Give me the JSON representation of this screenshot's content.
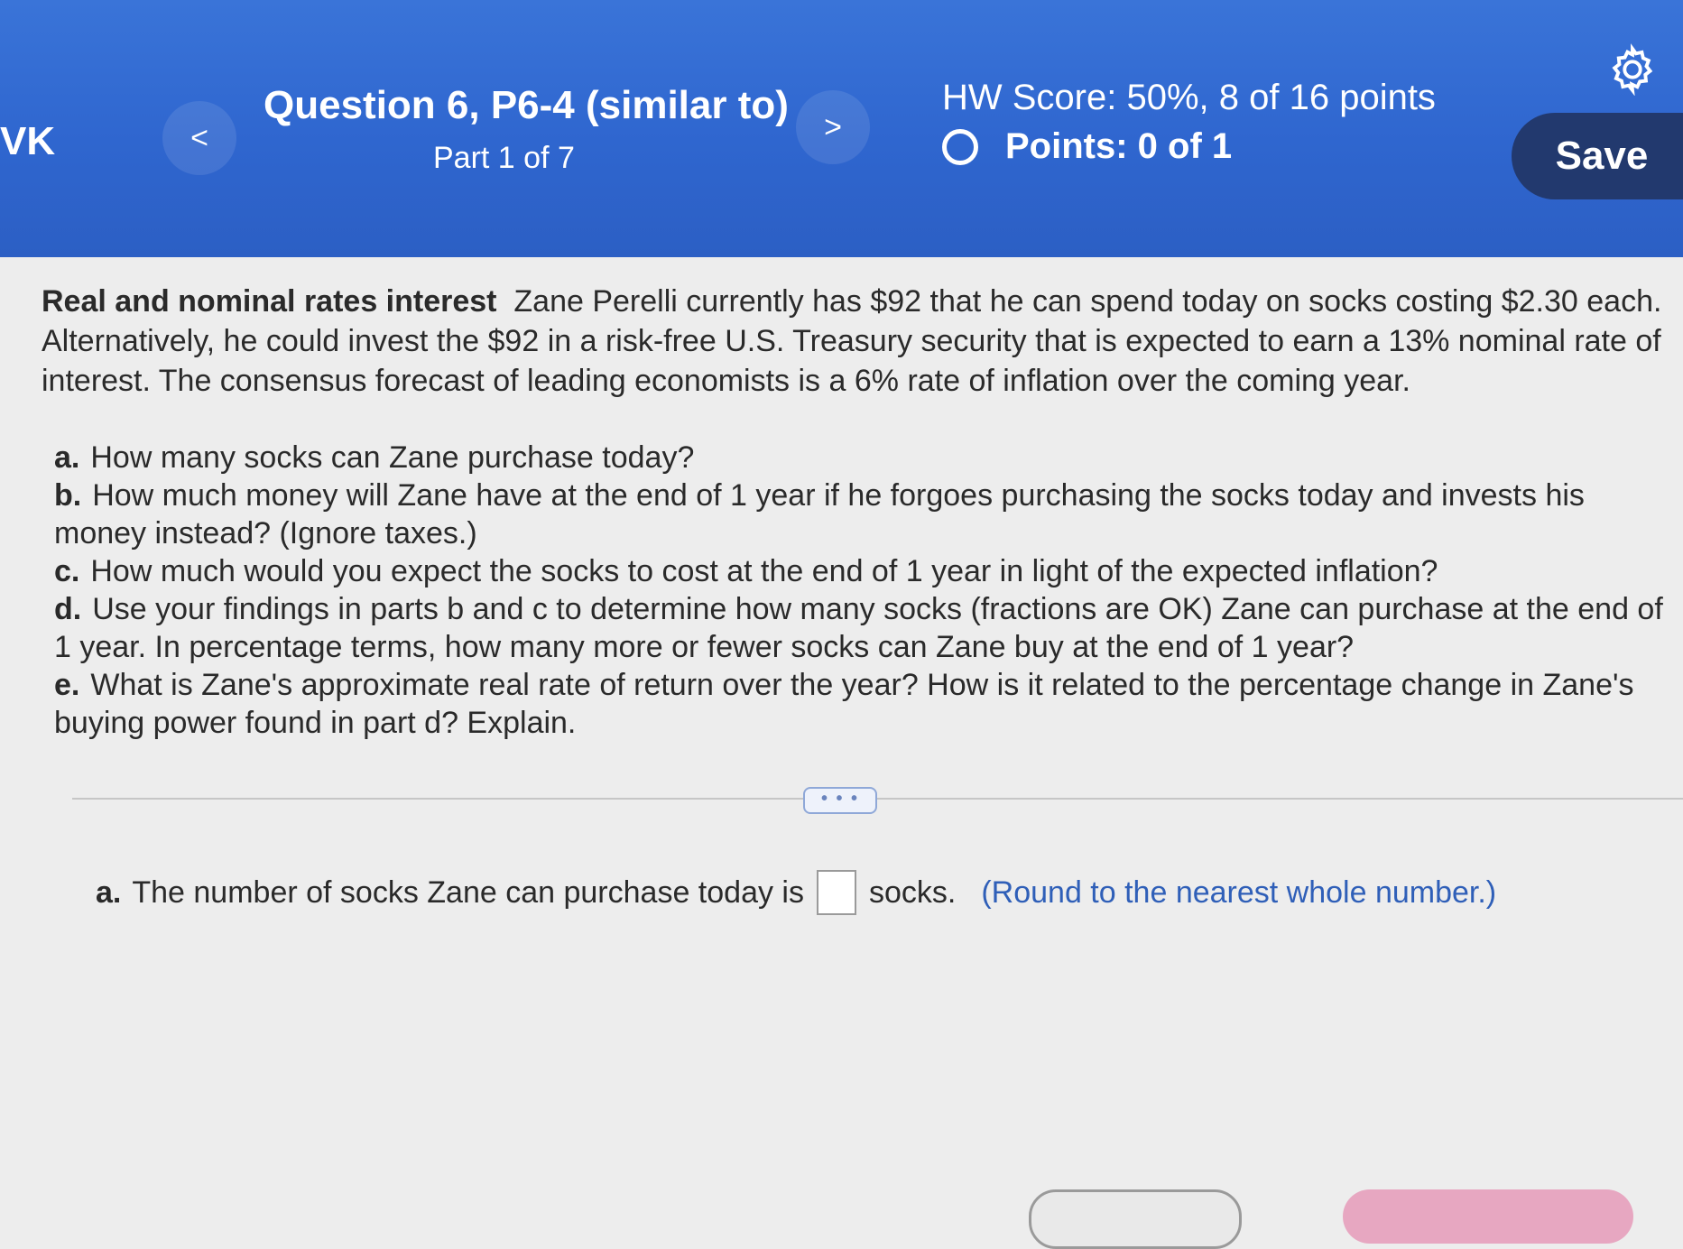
{
  "header": {
    "hw_label": "VK",
    "prev_label": "<",
    "next_label": ">",
    "question_title": "Question 6, P6-4 (similar to)",
    "question_part": "Part 1 of 7",
    "hw_score": "HW Score: 50%, 8 of 16 points",
    "points": "Points: 0 of 1",
    "save_label": "Save",
    "settings_icon": "gear-icon",
    "status_icon": "circle-icon"
  },
  "problem": {
    "topic": "Real and nominal rates interest",
    "text": "Zane Perelli currently has $92 that he can spend today on socks costing $2.30 each. Alternatively, he could invest the $92 in a risk-free U.S. Treasury security that is expected to earn a 13% nominal rate of interest. The consensus forecast of leading economists is a 6% rate of inflation over the coming year.",
    "parts": [
      {
        "letter": "a.",
        "text": "How many socks can Zane purchase today?"
      },
      {
        "letter": "b.",
        "text": "How much money will Zane have at the end of 1 year if he forgoes purchasing the socks today and invests his money instead? (Ignore taxes.)"
      },
      {
        "letter": "c.",
        "text": "How much would you expect the socks to cost at the end of 1 year in light of the expected inflation?"
      },
      {
        "letter": "d.",
        "text": "Use your findings in parts b and c to determine how many socks (fractions are OK) Zane can purchase at the end of 1 year. In percentage terms, how many more or fewer socks can Zane buy at the end of 1 year?"
      },
      {
        "letter": "e.",
        "text": "What is Zane's approximate real rate of return over the year? How is it related to the percentage change in Zane's buying power found in part d? Explain."
      }
    ]
  },
  "more_label": "• • •",
  "answer": {
    "letter": "a.",
    "prefix": "The number of socks Zane can purchase today is",
    "value": "",
    "suffix": "socks.",
    "hint": "(Round to the nearest whole number.)"
  },
  "colors": {
    "header_blue": "#2f66cf",
    "save_button": "#22396e",
    "hint_blue": "#2f5fb8",
    "check_button_pink": "#e7a7c1"
  }
}
